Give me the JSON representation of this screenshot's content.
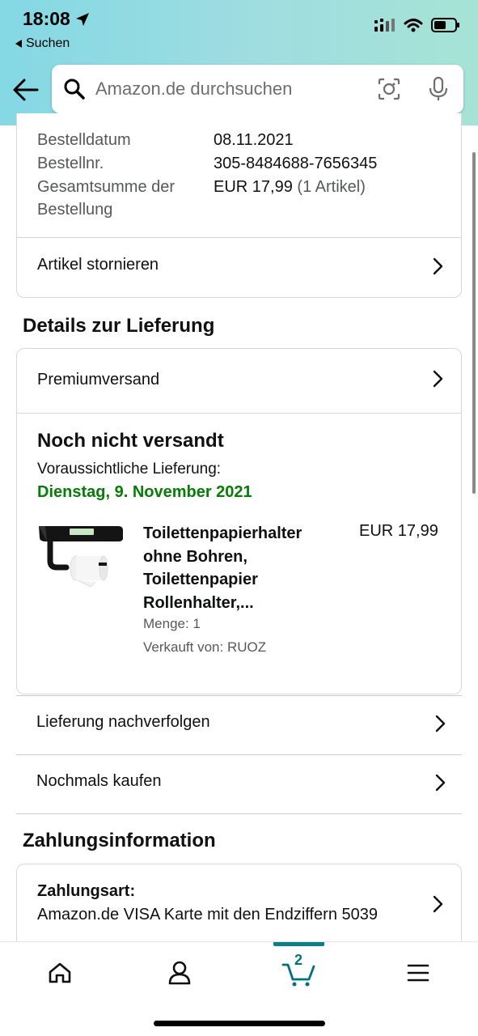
{
  "status_bar": {
    "time": "18:08",
    "back_label": "Suchen"
  },
  "search": {
    "placeholder": "Amazon.de durchsuchen"
  },
  "order_summary": {
    "date_label": "Bestelldatum",
    "date_value": "08.11.2021",
    "number_label": "Bestellnr.",
    "number_value": "305-8484688-7656345",
    "total_label_line1": "Gesamtsumme der",
    "total_label_line2": "Bestellung",
    "total_value": "EUR 17,99",
    "total_count": "(1 Artikel)",
    "cancel_label": "Artikel stornieren"
  },
  "delivery": {
    "section_title": "Details zur Lieferung",
    "shipping_method": "Premiumversand",
    "status": "Noch nicht versandt",
    "expected_label": "Voraussichtliche Lieferung:",
    "expected_date": "Dienstag, 9. November 2021",
    "item": {
      "title_line1": "Toilettenpapierhalter",
      "title_line2": "ohne Bohren,",
      "title_line3": "Toilettenpapier",
      "title_line4": "Rollenhalter,...",
      "price": "EUR 17,99",
      "quantity": "Menge: 1",
      "seller": "Verkauft von: RUOZ"
    },
    "track_label": "Lieferung nachverfolgen",
    "buy_again_label": "Nochmals kaufen"
  },
  "payment": {
    "section_title": "Zahlungsinformation",
    "method_label": "Zahlungsart:",
    "method_value": "Amazon.de VISA Karte mit den Endziffern 5039"
  },
  "bottom_nav": {
    "cart_count": "2"
  },
  "colors": {
    "header_start": "#84d8e4",
    "header_end": "#a6e3d6",
    "delivery_green": "#067d06",
    "cart_accent": "#007185"
  }
}
